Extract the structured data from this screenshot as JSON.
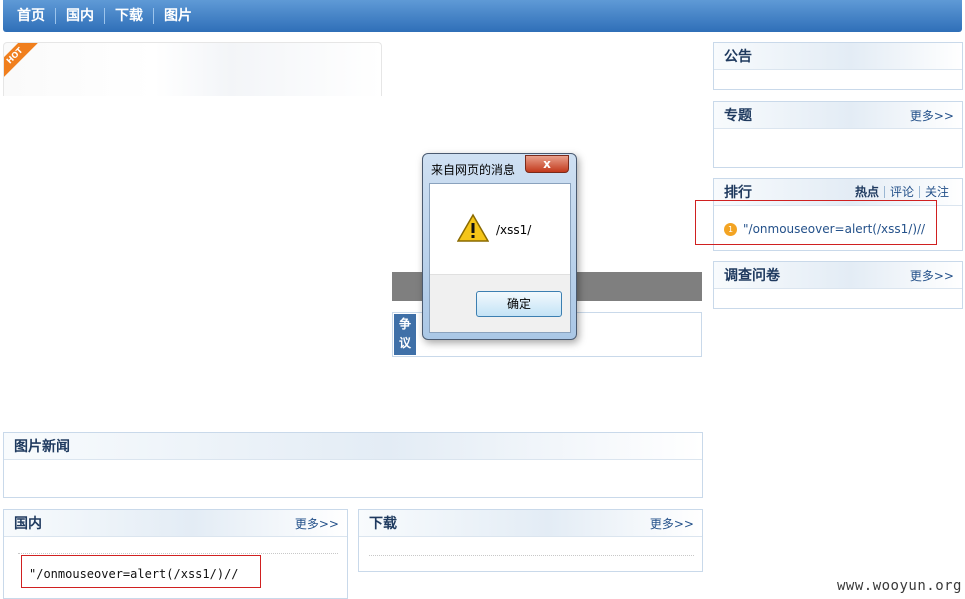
{
  "nav": {
    "items": [
      "首页",
      "国内",
      "下载",
      "图片"
    ]
  },
  "hot": {
    "ribbon": "HOT"
  },
  "announcement": {
    "title": "公告"
  },
  "topics": {
    "title": "专题",
    "more": "更多>>"
  },
  "ranking": {
    "title": "排行",
    "tabs": [
      "热点",
      "评论",
      "关注"
    ],
    "item_rank": "1",
    "item_text": "\"/onmouseover=alert(/xss1/)//"
  },
  "survey": {
    "title": "调查问卷",
    "more": "更多>>"
  },
  "dispute": {
    "tag": "争议"
  },
  "photo_news": {
    "title": "图片新闻"
  },
  "domestic": {
    "title": "国内",
    "more": "更多>>",
    "item_text": "\"/onmouseover=alert(/xss1/)//"
  },
  "download": {
    "title": "下载",
    "more": "更多>>"
  },
  "dialog": {
    "title": "来自网页的消息",
    "close": "x",
    "message": "/xss1/",
    "ok_label": "确定"
  },
  "watermark": "www.wooyun.org"
}
